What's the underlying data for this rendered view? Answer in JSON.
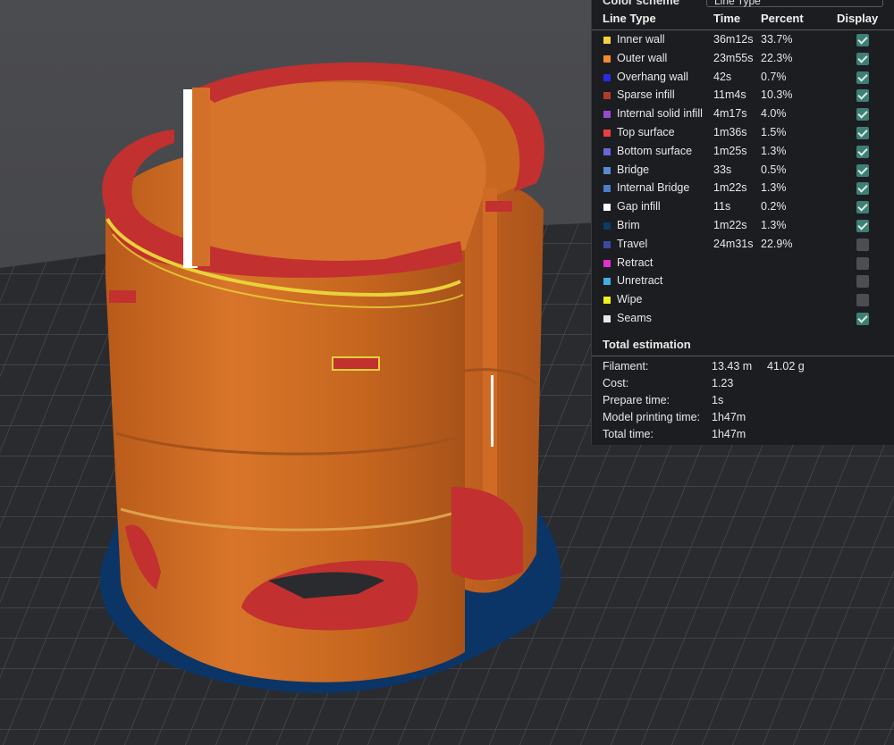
{
  "color_scheme": {
    "label": "Color scheme",
    "value": "Line Type"
  },
  "headers": {
    "line_type": "Line Type",
    "time": "Time",
    "percent": "Percent",
    "display": "Display"
  },
  "rows": [
    {
      "name": "Inner wall",
      "time": "36m12s",
      "percent": "33.7%",
      "color": "#f5d33a",
      "display": true
    },
    {
      "name": "Outer wall",
      "time": "23m55s",
      "percent": "22.3%",
      "color": "#f58a2a",
      "display": true
    },
    {
      "name": "Overhang wall",
      "time": "42s",
      "percent": "0.7%",
      "color": "#2a2ae6",
      "display": true
    },
    {
      "name": "Sparse infill",
      "time": "11m4s",
      "percent": "10.3%",
      "color": "#b23a2a",
      "display": true
    },
    {
      "name": "Internal solid infill",
      "time": "4m17s",
      "percent": "4.0%",
      "color": "#9a4ad0",
      "display": true
    },
    {
      "name": "Top surface",
      "time": "1m36s",
      "percent": "1.5%",
      "color": "#e84040",
      "display": true
    },
    {
      "name": "Bottom surface",
      "time": "1m25s",
      "percent": "1.3%",
      "color": "#6a66d8",
      "display": true
    },
    {
      "name": "Bridge",
      "time": "33s",
      "percent": "0.5%",
      "color": "#5a8ad0",
      "display": true
    },
    {
      "name": "Internal Bridge",
      "time": "1m22s",
      "percent": "1.3%",
      "color": "#4a7ec8",
      "display": true
    },
    {
      "name": "Gap infill",
      "time": "11s",
      "percent": "0.2%",
      "color": "#ffffff",
      "display": true
    },
    {
      "name": "Brim",
      "time": "1m22s",
      "percent": "1.3%",
      "color": "#0a3a6a",
      "display": true
    },
    {
      "name": "Travel",
      "time": "24m31s",
      "percent": "22.9%",
      "color": "#3a4aa0",
      "display": false
    },
    {
      "name": "Retract",
      "time": "",
      "percent": "",
      "color": "#e030d0",
      "display": false
    },
    {
      "name": "Unretract",
      "time": "",
      "percent": "",
      "color": "#40b0e0",
      "display": false
    },
    {
      "name": "Wipe",
      "time": "",
      "percent": "",
      "color": "#f0f020",
      "display": false
    },
    {
      "name": "Seams",
      "time": "",
      "percent": "",
      "color": "#e8e8e8",
      "display": true
    }
  ],
  "total": {
    "title": "Total estimation",
    "filament_label": "Filament:",
    "filament_length": "13.43 m",
    "filament_weight": "41.02 g",
    "cost_label": "Cost:",
    "cost": "1.23",
    "prepare_label": "Prepare time:",
    "prepare": "1s",
    "model_label": "Model printing time:",
    "model": "1h47m",
    "total_label": "Total time:",
    "total_time": "1h47m"
  },
  "colors": {
    "plate": "#2b2c30",
    "wall": "#c9661f",
    "top": "#c23030",
    "brim": "#0b3566",
    "background": "#4a4a4e"
  }
}
